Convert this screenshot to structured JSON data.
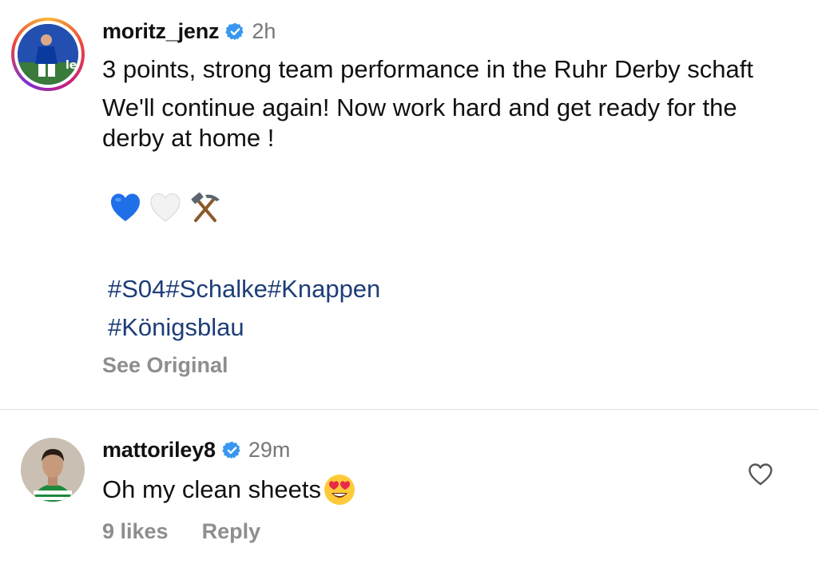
{
  "post": {
    "username": "moritz_jenz",
    "time": "2h",
    "caption_line1": "3 points, strong team performance in the Ruhr Derby schaft",
    "caption_line2": "We'll continue again! Now work hard and get ready for the derby at home !",
    "emojis": [
      "blue-heart",
      "white-heart",
      "hammer-and-pick"
    ],
    "hashtags_line1": "#S04#Schalke#Knappen",
    "hashtags_line2": "#Königsblau",
    "see_original": "See Original"
  },
  "comment": {
    "username": "mattoriley8",
    "time": "29m",
    "text": "Oh my clean sheets",
    "emoji": "heart-eyes",
    "likes": "9 likes",
    "reply": "Reply"
  },
  "colors": {
    "hashtag": "#1e3e78",
    "verified": "#3897f0",
    "muted": "#8e8e8e"
  }
}
